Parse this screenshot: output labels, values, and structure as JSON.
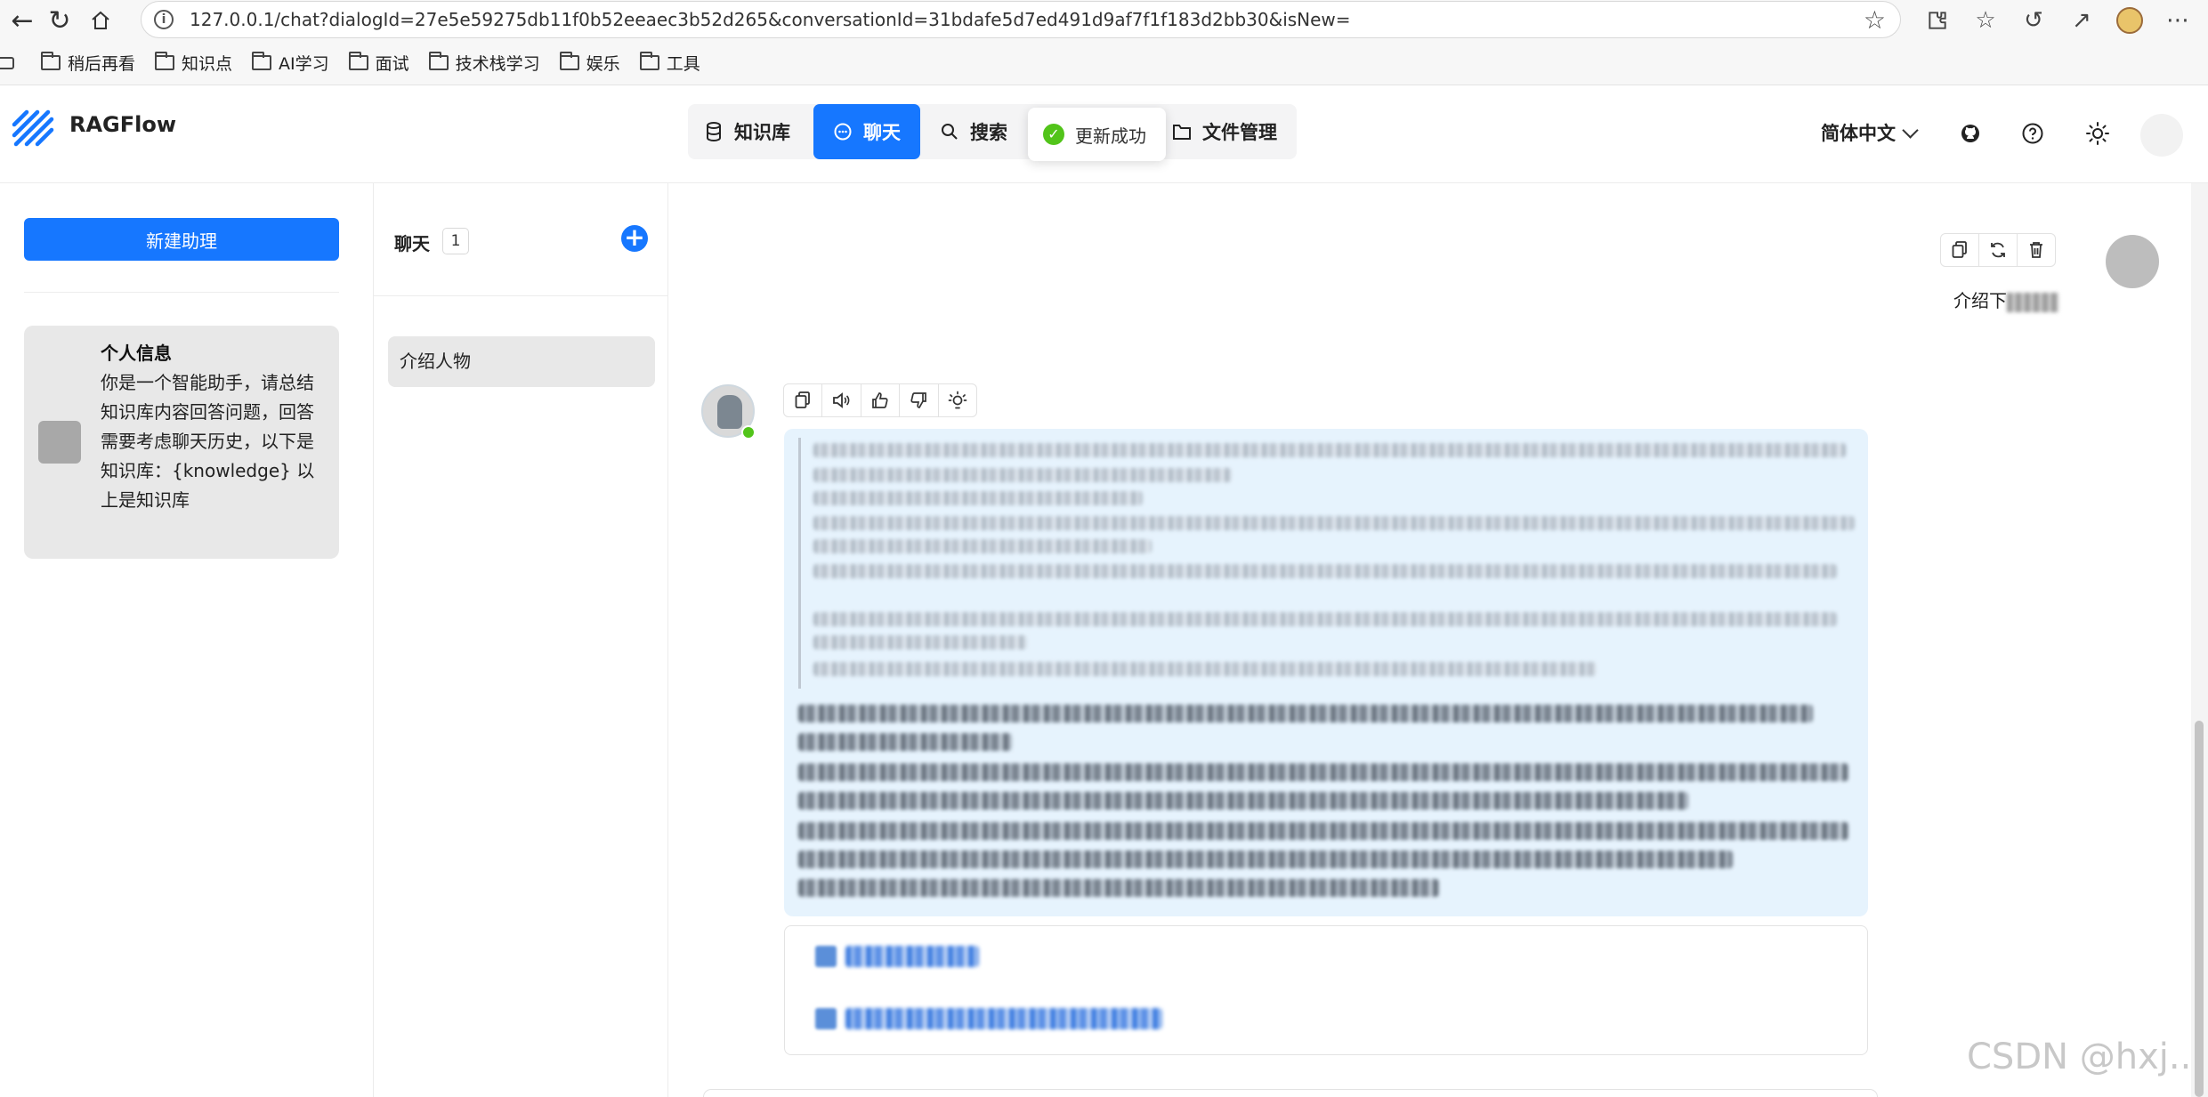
{
  "browser": {
    "url": "127.0.0.1/chat?dialogId=27e5e59275db11f0b52eeaec3b52d265&conversationId=31bdafe5d7ed491d9af7f1f183d2bb30&isNew=",
    "bookmarks": [
      "稍后再看",
      "知识点",
      "AI学习",
      "面试",
      "技术栈学习",
      "娱乐",
      "工具"
    ]
  },
  "app": {
    "brand": "RAGFlow",
    "nav": [
      {
        "label": "知识库",
        "icon": "database-icon"
      },
      {
        "label": "聊天",
        "icon": "chat-icon",
        "active": true
      },
      {
        "label": "搜索",
        "icon": "search-icon"
      },
      {
        "label": "文件管理",
        "icon": "folder-icon"
      }
    ],
    "toast": "更新成功",
    "language": "简体中文",
    "accent": "#1677ff"
  },
  "sidebar": {
    "new_button": "新建助理",
    "assistant": {
      "title": "个人信息",
      "description": "你是一个智能助手，请总结知识库内容回答问题，回答需要考虑聊天历史，以下是知识库：{knowledge} 以上是知识库"
    }
  },
  "conversations": {
    "header": "聊天",
    "count": "1",
    "items": [
      "介绍人物"
    ]
  },
  "chat": {
    "user_message_prefix": "介绍下",
    "watermark": "CSDN @hxj.."
  }
}
